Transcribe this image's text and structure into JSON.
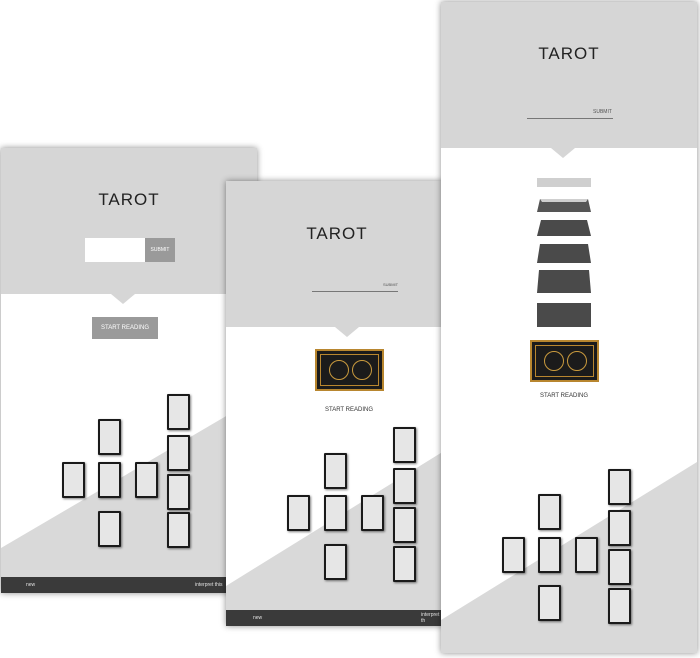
{
  "app": {
    "title": "TAROT"
  },
  "screen1": {
    "title": "TAROT",
    "submit_label": "SUBMIT",
    "start_label": "START READING",
    "footer": {
      "left": "new",
      "right": "interpret this"
    }
  },
  "screen2": {
    "title": "TAROT",
    "submit_label": "SUBMIT",
    "start_label": "START READING",
    "footer": {
      "left": "new",
      "right": "interpret th"
    }
  },
  "screen3": {
    "title": "TAROT",
    "submit_label": "SUBMIT",
    "start_label": "START READING"
  },
  "colors": {
    "header_bg": "#d6d6d6",
    "button_bg": "#9a9a9a",
    "footer_bg": "#3a3a3a",
    "card_fill": "#e6e6e6",
    "deck_gold": "#b8862f"
  },
  "icons": [
    "card-deck-icon"
  ]
}
